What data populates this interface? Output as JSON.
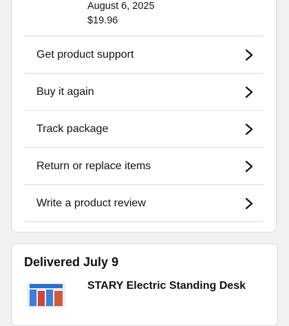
{
  "order": {
    "date": "August 6, 2025",
    "price": "$19.96"
  },
  "actions": [
    {
      "label": "Get product support"
    },
    {
      "label": "Buy it again"
    },
    {
      "label": "Track package"
    },
    {
      "label": "Return or replace items"
    },
    {
      "label": "Write a product review"
    }
  ],
  "next_order": {
    "status": "Delivered July 9",
    "product_title": "STARY Electric Standing Desk"
  },
  "colors": {
    "background": "#f0f2f2",
    "card": "#ffffff",
    "border": "#d5d9d9",
    "text": "#0f1111"
  }
}
